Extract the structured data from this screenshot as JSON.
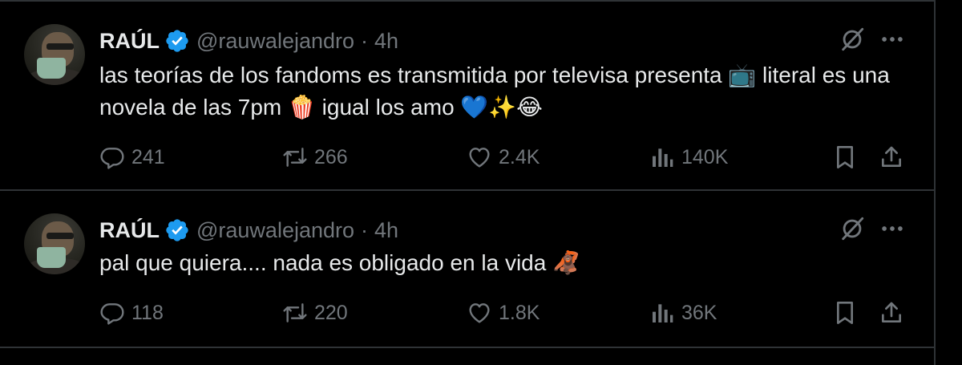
{
  "colors": {
    "background": "#000000",
    "text_primary": "#e7e9ea",
    "text_secondary": "#71767b",
    "verified_blue": "#1d9bf0",
    "divider": "#2f3336"
  },
  "tweets": [
    {
      "author_name": "RAÚL",
      "handle": "@rauwalejandro",
      "separator": "·",
      "time": "4h",
      "text": "las teorías de los fandoms es transmitida por televisa presenta 📺 literal es una novela de las 7pm 🍿 igual los amo 💙✨😂",
      "replies": "241",
      "reposts": "266",
      "likes": "2.4K",
      "views": "140K"
    },
    {
      "author_name": "RAÚL",
      "handle": "@rauwalejandro",
      "separator": "·",
      "time": "4h",
      "text": "pal que quiera.... nada es obligado en la vida 🦧",
      "replies": "118",
      "reposts": "220",
      "likes": "1.8K",
      "views": "36K"
    }
  ]
}
